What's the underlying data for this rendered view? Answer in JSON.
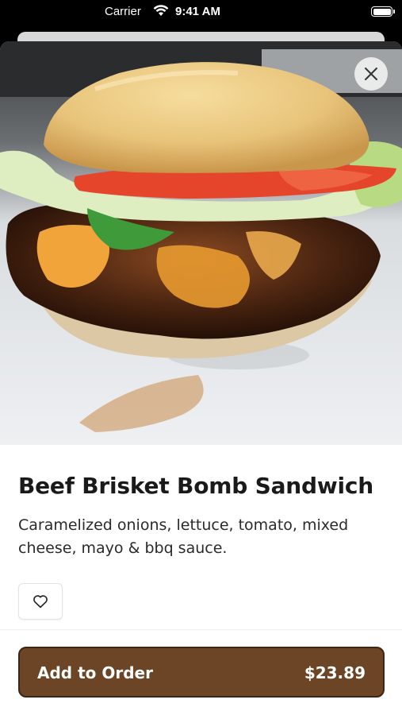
{
  "status_bar": {
    "carrier": "Carrier",
    "time": "9:41 AM"
  },
  "item": {
    "title": "Beef Brisket Bomb Sandwich",
    "description": "Caramelized onions, lettuce, tomato, mixed cheese, mayo & bbq sauce.",
    "image_icon": "burger-photo"
  },
  "actions": {
    "add_label": "Add to Order",
    "price": "$23.89"
  },
  "colors": {
    "primary_button": "#6b4526",
    "primary_button_border": "#3e2614",
    "title_text": "#1a1a1a"
  },
  "icons": {
    "close": "close-icon",
    "favorite": "heart-icon",
    "wifi": "wifi-icon",
    "battery": "battery-icon"
  }
}
